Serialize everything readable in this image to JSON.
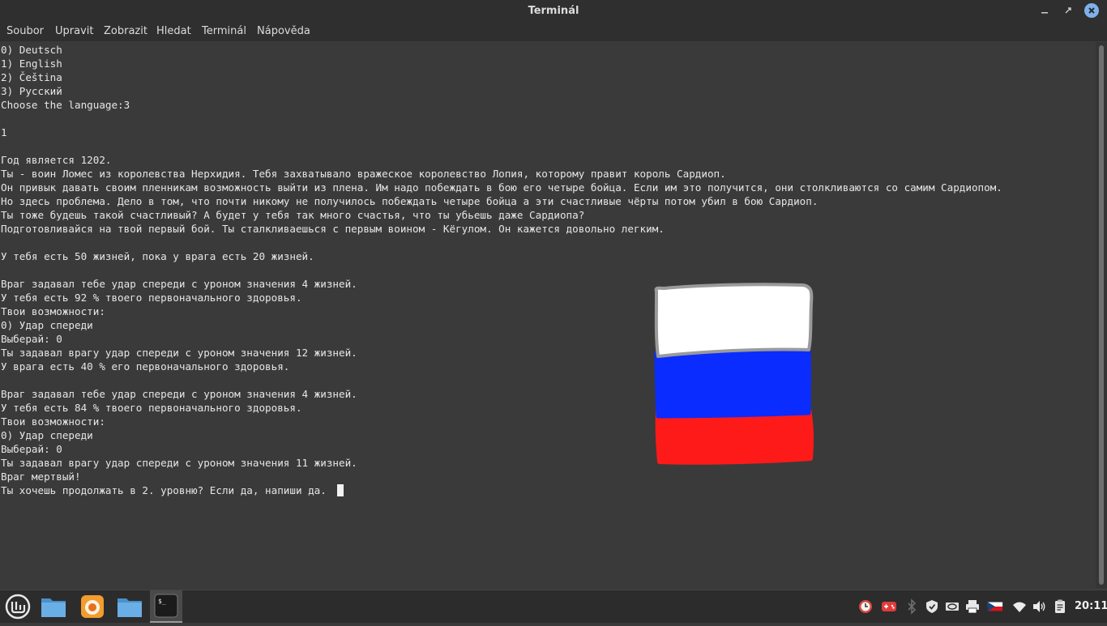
{
  "window": {
    "title": "Terminál"
  },
  "menu": [
    "Soubor",
    "Upravit",
    "Zobrazit",
    "Hledat",
    "Terminál",
    "Nápověda"
  ],
  "terminal": {
    "lines": [
      "0) Deutsch",
      "1) English",
      "2) Čeština",
      "3) Русский",
      "Choose the language:3",
      "",
      "1",
      "",
      "Год является 1202.",
      "Ты - воин Ломес из королевства Нерхидия. Тебя захватывало вражеское королевство Лопия, которому правит король Сардиоп.",
      "Он привык давать своим пленникам возможность выйти из плена. Им надо побеждать в бою его четыре бойца. Если им это получится, они столкливаются со самим Сардиопом.",
      "Но здесь проблема. Дело в том, что почти никому не получилось побеждать четыре бойца а эти счастливые чёрты потом убил в бою Сардиоп.",
      "Ты тоже будешь такой счастливый? А будет у тебя так много счастья, что ты убьешь даже Сардиопа?",
      "Подготовливайся на твой первый бой. Ты сталкливаешься с первым воином - Кёгулом. Он кажется довольно легким.",
      "",
      "У тебя есть 50 жизней, пока у врага есть 20 жизней.",
      "",
      "Враг задавал тебе удар спереди с уроном значения 4 жизней.",
      "У тебя есть 92 % твоего первоначального здоровья.",
      "Твои возможности:",
      "0) Удар спереди",
      "Выберай: 0",
      "Ты задавал врагу удар спереди с уроном значения 12 жизней.",
      "У врага есть 40 % его первоначального здоровья.",
      "",
      "Враг задавал тебе удар спереди с уроном значения 4 жизней.",
      "У тебя есть 84 % твоего первоначального здоровья.",
      "Твои возможности:",
      "0) Удар спереди",
      "Выберай: 0",
      "Ты задавал врагу удар спереди с уроном значения 11 жизней.",
      "Враг мертвый!",
      "Ты хочешь продолжать в 2. уровню? Если да, напиши да. "
    ]
  },
  "flag": {
    "colors": [
      "#ffffff",
      "#0a2cff",
      "#ff1a1a"
    ]
  },
  "taskbar": {
    "apps": [
      {
        "name": "mint-menu-icon"
      },
      {
        "name": "files-icon"
      },
      {
        "name": "firefox-icon"
      },
      {
        "name": "folder-icon"
      },
      {
        "name": "terminal-icon"
      }
    ],
    "tray": [
      "timeshift-icon",
      "game-icon",
      "bluetooth-icon",
      "shield-icon",
      "nvidia-icon",
      "printer-icon",
      "keyboard-layout-flag-icon",
      "wifi-icon",
      "volume-icon",
      "clipboard-icon"
    ],
    "clock": "20:11"
  }
}
